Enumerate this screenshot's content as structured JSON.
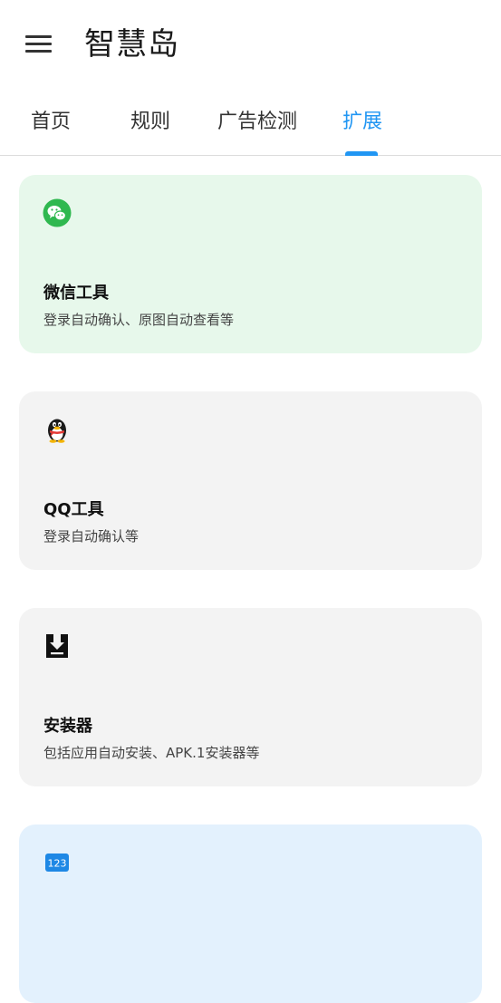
{
  "appbar": {
    "menu_icon": "hamburger-menu-icon",
    "title": "智慧岛"
  },
  "tabs": [
    {
      "label": "首页"
    },
    {
      "label": "规则"
    },
    {
      "label": "广告检测"
    },
    {
      "label": "扩展",
      "active": true
    }
  ],
  "colors": {
    "accent": "#2196f3",
    "wechat_card_bg": "#e7f8eb",
    "neutral_card_bg": "#f3f3f3",
    "blue_card_bg": "#e3f1fd",
    "wechat_green": "#2fb84f"
  },
  "cards": [
    {
      "icon": "wechat-icon",
      "title": "微信工具",
      "desc": "登录自动确认、原图自动查看等"
    },
    {
      "icon": "qq-penguin-icon",
      "title": "QQ工具",
      "desc": "登录自动确认等"
    },
    {
      "icon": "install-download-icon",
      "title": "安装器",
      "desc": "包括应用自动安装、APK.1安装器等"
    },
    {
      "icon": "numbers-123-icon",
      "icon_text": "123",
      "title": "",
      "desc": ""
    }
  ]
}
